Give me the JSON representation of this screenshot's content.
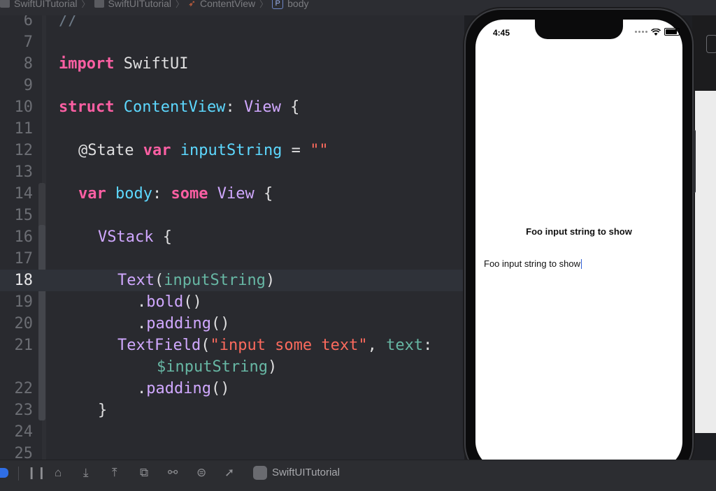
{
  "breadcrumb": {
    "items": [
      "SwiftUITutorial",
      "SwiftUITutorial",
      "ContentView",
      "body"
    ],
    "badge": "P"
  },
  "editor": {
    "lines": [
      {
        "n": "6",
        "tokens": [
          {
            "t": "//",
            "c": "cmt"
          }
        ]
      },
      {
        "n": "7",
        "tokens": []
      },
      {
        "n": "8",
        "tokens": [
          {
            "t": "import",
            "c": "kw"
          },
          {
            "t": " SwiftUI",
            "c": "plain"
          }
        ]
      },
      {
        "n": "9",
        "tokens": []
      },
      {
        "n": "10",
        "tokens": [
          {
            "t": "struct",
            "c": "kw"
          },
          {
            "t": " ",
            "c": "plain"
          },
          {
            "t": "ContentView",
            "c": "type"
          },
          {
            "t": ": ",
            "c": "plain"
          },
          {
            "t": "View",
            "c": "sys"
          },
          {
            "t": " {",
            "c": "plain"
          }
        ]
      },
      {
        "n": "11",
        "tokens": []
      },
      {
        "n": "12",
        "indent": 1,
        "tokens": [
          {
            "t": "@State",
            "c": "plain"
          },
          {
            "t": " ",
            "c": "plain"
          },
          {
            "t": "var",
            "c": "kw"
          },
          {
            "t": " ",
            "c": "plain"
          },
          {
            "t": "inputString",
            "c": "type"
          },
          {
            "t": " = ",
            "c": "plain"
          },
          {
            "t": "\"\"",
            "c": "str"
          }
        ]
      },
      {
        "n": "13",
        "tokens": []
      },
      {
        "n": "14",
        "indent": 1,
        "tokens": [
          {
            "t": "var",
            "c": "kw"
          },
          {
            "t": " ",
            "c": "plain"
          },
          {
            "t": "body",
            "c": "type"
          },
          {
            "t": ": ",
            "c": "plain"
          },
          {
            "t": "some",
            "c": "kw"
          },
          {
            "t": " ",
            "c": "plain"
          },
          {
            "t": "View",
            "c": "sys"
          },
          {
            "t": " {",
            "c": "plain"
          }
        ]
      },
      {
        "n": "15",
        "tokens": []
      },
      {
        "n": "16",
        "indent": 2,
        "tokens": [
          {
            "t": "VStack",
            "c": "sys"
          },
          {
            "t": " {",
            "c": "plain"
          }
        ]
      },
      {
        "n": "17",
        "tokens": []
      },
      {
        "n": "18",
        "current": true,
        "indent": 3,
        "tokens": [
          {
            "t": "Text",
            "c": "sys"
          },
          {
            "t": "(",
            "c": "plain"
          },
          {
            "t": "inputString",
            "c": "prop"
          },
          {
            "t": ")",
            "c": "plain"
          }
        ]
      },
      {
        "n": "19",
        "indent": 4,
        "tokens": [
          {
            "t": ".",
            "c": "plain"
          },
          {
            "t": "bold",
            "c": "sys"
          },
          {
            "t": "()",
            "c": "plain"
          }
        ]
      },
      {
        "n": "20",
        "indent": 4,
        "tokens": [
          {
            "t": ".",
            "c": "plain"
          },
          {
            "t": "padding",
            "c": "sys"
          },
          {
            "t": "()",
            "c": "plain"
          }
        ]
      },
      {
        "n": "21",
        "indent": 3,
        "tokens": [
          {
            "t": "TextField",
            "c": "sys"
          },
          {
            "t": "(",
            "c": "plain"
          },
          {
            "t": "\"input some text\"",
            "c": "str"
          },
          {
            "t": ", ",
            "c": "plain"
          },
          {
            "t": "text",
            "c": "prop"
          },
          {
            "t": ":",
            "c": "plain"
          }
        ]
      },
      {
        "n": "",
        "indent": 5,
        "tokens": [
          {
            "t": "$inputString",
            "c": "prop"
          },
          {
            "t": ")",
            "c": "plain"
          }
        ]
      },
      {
        "n": "22",
        "indent": 4,
        "tokens": [
          {
            "t": ".",
            "c": "plain"
          },
          {
            "t": "padding",
            "c": "sys"
          },
          {
            "t": "()",
            "c": "plain"
          }
        ]
      },
      {
        "n": "23",
        "indent": 2,
        "tokens": [
          {
            "t": "}",
            "c": "plain"
          }
        ]
      },
      {
        "n": "24",
        "tokens": []
      },
      {
        "n": "25",
        "tokens": []
      }
    ]
  },
  "simulator": {
    "time": "4:45",
    "bold_text": "Foo input string to show",
    "field_text": "Foo input string to show"
  },
  "toolbar": {
    "scheme": "SwiftUITutorial",
    "icons": [
      "pause-icon",
      "step-over-icon",
      "step-into-icon",
      "step-out-icon",
      "view-hierarchy-icon",
      "memory-graph-icon",
      "environment-icon",
      "location-icon"
    ]
  }
}
